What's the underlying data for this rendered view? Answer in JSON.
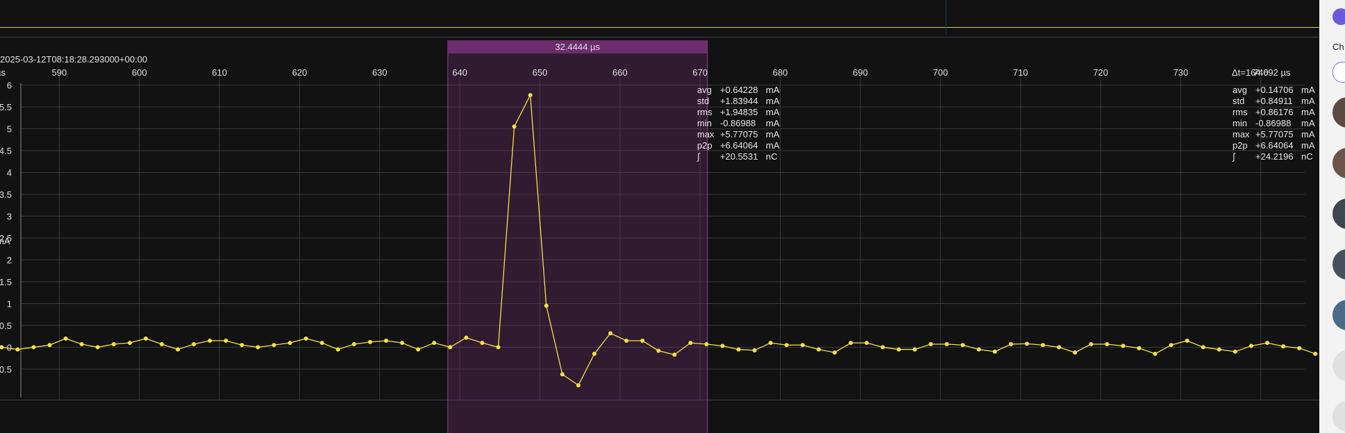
{
  "timestamp": "2025-03-12T08:18:28.293000+00:00",
  "x_unit_label": "µs",
  "delta_t": "Δt=164.692 µs",
  "selection": {
    "duration": "32.4444 µs",
    "color": "#6c2d6c"
  },
  "trace_color": "#f5e14a",
  "stats_selection": [
    {
      "name": "avg",
      "value": "+0.64228",
      "unit": "mA"
    },
    {
      "name": "std",
      "value": "+1.83944",
      "unit": "mA"
    },
    {
      "name": "rms",
      "value": "+1.94835",
      "unit": "mA"
    },
    {
      "name": "min",
      "value": "-0.86988",
      "unit": "mA"
    },
    {
      "name": "max",
      "value": "+5.77075",
      "unit": "mA"
    },
    {
      "name": "p2p",
      "value": "+6.64064",
      "unit": "mA"
    },
    {
      "name": "∫",
      "value": "+20.5531",
      "unit": "nC"
    }
  ],
  "stats_view": [
    {
      "name": "avg",
      "value": "+0.14706",
      "unit": "mA"
    },
    {
      "name": "std",
      "value": "+0.84911",
      "unit": "mA"
    },
    {
      "name": "rms",
      "value": "+0.86176",
      "unit": "mA"
    },
    {
      "name": "min",
      "value": "-0.86988",
      "unit": "mA"
    },
    {
      "name": "max",
      "value": "+5.77075",
      "unit": "mA"
    },
    {
      "name": "p2p",
      "value": "+6.64064",
      "unit": "mA"
    },
    {
      "name": "∫",
      "value": "+24.2196",
      "unit": "nC"
    }
  ],
  "right_panel": {
    "label": "Ch"
  },
  "chart_data": {
    "type": "line",
    "title": "",
    "xlabel": "µs",
    "ylabel": "mA",
    "xlim": [
      582.6,
      747.3
    ],
    "ylim": [
      -1.2,
      6.2
    ],
    "x_ticks": [
      590,
      600,
      610,
      620,
      630,
      640,
      650,
      660,
      670,
      680,
      690,
      700,
      710,
      720,
      730,
      740
    ],
    "y_ticks": [
      -0.5,
      0,
      0.5,
      1,
      1.5,
      2,
      2.5,
      3,
      3.5,
      4,
      4.5,
      5,
      5.5,
      6
    ],
    "y_tick_labels": [
      "-0.5",
      "0",
      "0.5",
      "1",
      "1.5",
      "2",
      "2.5",
      "3",
      "3.5",
      "4",
      "4.5",
      "5",
      "5.5",
      "6"
    ],
    "grid": true,
    "selection_range": [
      638.5,
      670.9
    ],
    "series": [
      {
        "x": [
          582.8,
          584.8,
          586.8,
          588.8,
          590.8,
          592.8,
          594.8,
          596.8,
          598.8,
          600.8,
          602.8,
          604.8,
          606.8,
          608.8,
          610.8,
          612.8,
          614.8,
          616.8,
          618.8,
          620.8,
          622.8,
          624.8,
          626.8,
          628.8,
          630.8,
          632.8,
          634.8,
          636.8,
          638.8,
          640.8,
          642.8,
          644.8,
          646.8,
          648.8,
          650.8,
          652.8,
          654.8,
          656.8,
          658.8,
          660.8,
          662.8,
          664.8,
          666.8,
          668.8,
          670.8,
          672.8,
          674.8,
          676.8,
          678.8,
          680.8,
          682.8,
          684.8,
          686.8,
          688.8,
          690.8,
          692.8,
          694.8,
          696.8,
          698.8,
          700.8,
          702.8,
          704.8,
          706.8,
          708.8,
          710.8,
          712.8,
          714.8,
          716.8,
          718.8,
          720.8,
          722.8,
          724.8,
          726.8,
          728.8,
          730.8,
          732.8,
          734.8,
          736.8,
          738.8,
          740.8,
          742.8,
          744.8,
          746.8
        ],
        "y": [
          0.0,
          -0.05,
          0.0,
          0.05,
          0.2,
          0.07,
          0.0,
          0.07,
          0.1,
          0.2,
          0.07,
          -0.05,
          0.07,
          0.15,
          0.15,
          0.05,
          0.0,
          0.05,
          0.1,
          0.2,
          0.1,
          -0.05,
          0.07,
          0.12,
          0.15,
          0.1,
          -0.05,
          0.1,
          0.0,
          0.22,
          0.1,
          0.0,
          5.05,
          5.77,
          0.95,
          -0.62,
          -0.87,
          -0.15,
          0.32,
          0.15,
          0.15,
          -0.08,
          -0.17,
          0.1,
          0.07,
          0.03,
          -0.05,
          -0.07,
          0.1,
          0.05,
          0.05,
          -0.05,
          -0.12,
          0.1,
          0.1,
          0.0,
          -0.05,
          -0.05,
          0.07,
          0.07,
          0.05,
          -0.05,
          -0.1,
          0.07,
          0.08,
          0.05,
          0.0,
          -0.12,
          0.07,
          0.07,
          0.03,
          -0.02,
          -0.15,
          0.05,
          0.15,
          0.0,
          -0.05,
          -0.1,
          0.03,
          0.1,
          0.02,
          -0.02,
          -0.15
        ]
      }
    ]
  }
}
